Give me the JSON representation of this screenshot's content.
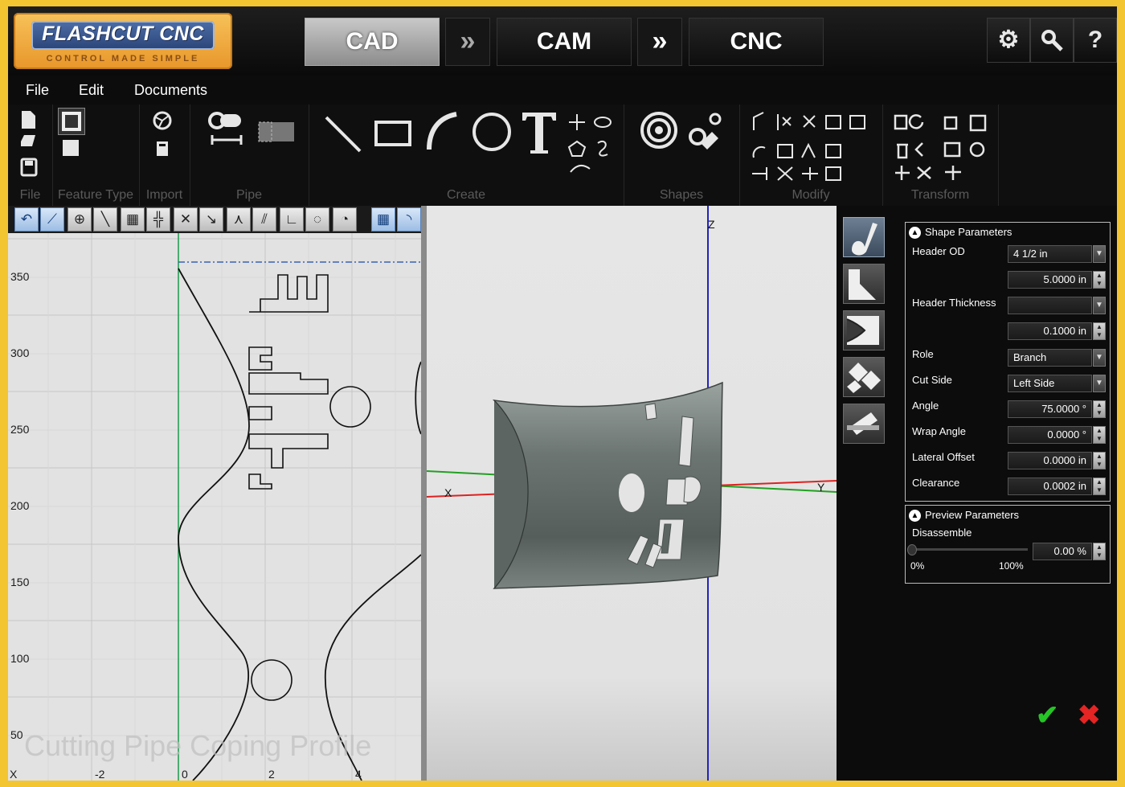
{
  "logo": {
    "name": "FLASHCUT CNC",
    "tagline": "CONTROL MADE SIMPLE"
  },
  "modes": {
    "cad": "CAD",
    "cam": "CAM",
    "cnc": "CNC",
    "arrow": "»",
    "active": "CAD"
  },
  "system_buttons": {
    "settings": "⚙",
    "key": "🔍",
    "help": "?"
  },
  "menu": {
    "file": "File",
    "edit": "Edit",
    "documents": "Documents"
  },
  "ribbon": {
    "groups": {
      "file": "File",
      "feature_type": "Feature Type",
      "import": "Import",
      "pipe": "Pipe",
      "create": "Create",
      "shapes": "Shapes",
      "modify": "Modify",
      "transform": "Transform"
    }
  },
  "view2d": {
    "y_ticks": [
      "350",
      "300",
      "250",
      "200",
      "150",
      "100",
      "50"
    ],
    "x_ticks": [
      "-2",
      "0",
      "2",
      "4"
    ],
    "x_axis": "X",
    "watermark": "Cutting Pipe Coping Profile"
  },
  "view3d": {
    "axis_x": "X",
    "axis_y": "Y",
    "axis_z": "Z"
  },
  "shape_parameters": {
    "title": "Shape Parameters",
    "header_od_label": "Header OD",
    "header_od_select": "4 1/2 in",
    "header_od_value": "5.0000 in",
    "header_thickness_label": "Header Thickness",
    "header_thickness_select": "",
    "header_thickness_value": "0.1000 in",
    "role_label": "Role",
    "role_value": "Branch",
    "cut_side_label": "Cut Side",
    "cut_side_value": "Left Side",
    "angle_label": "Angle",
    "angle_value": "75.0000 °",
    "wrap_angle_label": "Wrap Angle",
    "wrap_angle_value": "0.0000 °",
    "lateral_offset_label": "Lateral Offset",
    "lateral_offset_value": "0.0000 in",
    "clearance_label": "Clearance",
    "clearance_value": "0.0002 in"
  },
  "preview_parameters": {
    "title": "Preview Parameters",
    "disassemble_label": "Disassemble",
    "disassemble_value": "0.00 %",
    "disassemble_fraction": 0.0,
    "min_label": "0%",
    "max_label": "100%"
  },
  "actions": {
    "ok": "✔",
    "cancel": "✖"
  },
  "colors": {
    "accent_gold": "#f3c531",
    "axis_red": "#d22",
    "axis_green": "#1a1",
    "axis_blue": "#22c",
    "ok_green": "#27c427",
    "cancel_red": "#e52424"
  }
}
